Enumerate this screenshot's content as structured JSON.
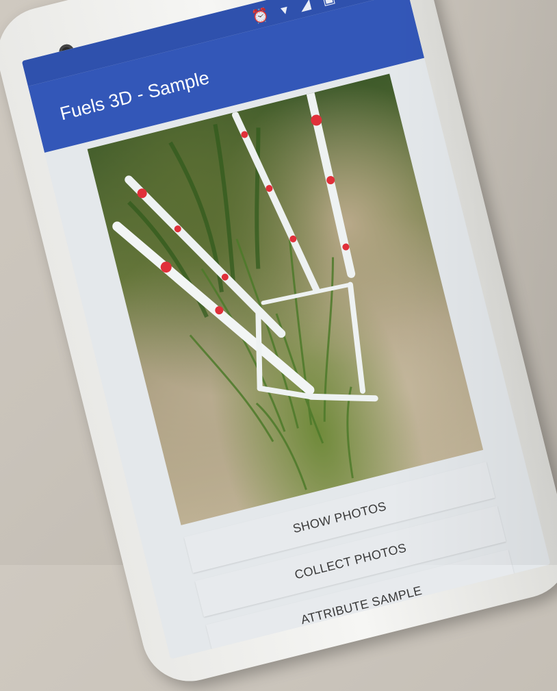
{
  "app": {
    "title": "Fuels 3D - Sample"
  },
  "status_bar": {
    "icons_text": "⏰ ▾ ◢ ▣ ▮"
  },
  "buttons": {
    "show_photos": "SHOW PHOTOS",
    "collect_photos": "COLLECT PHOTOS",
    "attribute_sample": "ATTRIBUTE SAMPLE"
  },
  "colors": {
    "app_bar": "#3357b8",
    "status_bar": "#2f51ad",
    "marker_red": "#e0303a"
  },
  "icons": [
    "front-camera-icon",
    "alarm-icon",
    "wifi-icon",
    "cell-signal-icon",
    "sim-icon",
    "battery-icon"
  ]
}
